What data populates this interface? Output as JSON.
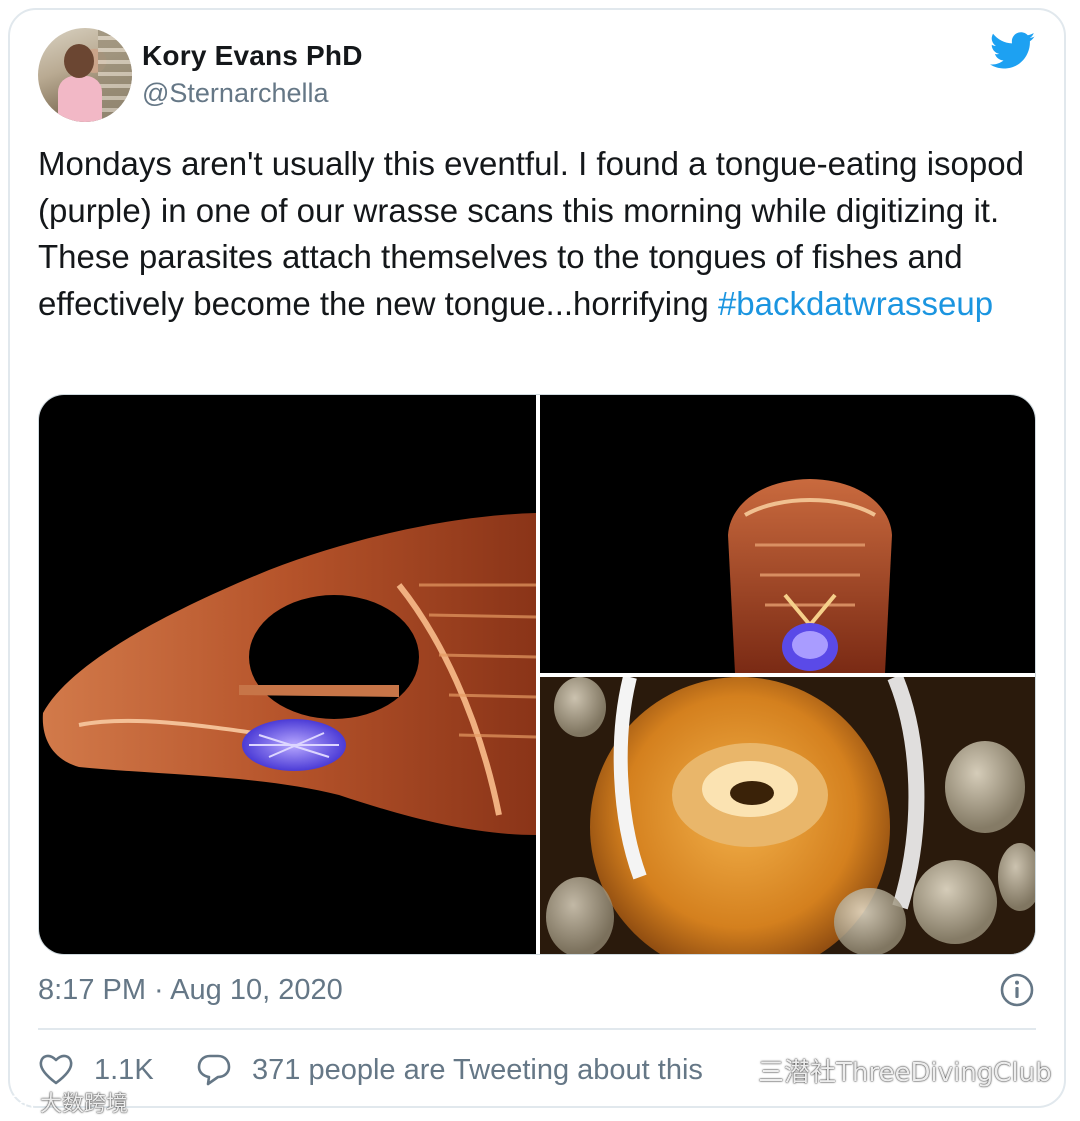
{
  "tweet": {
    "author": {
      "display_name": "Kory Evans PhD",
      "handle": "@Sternarchella",
      "avatar_icon": "profile-photo"
    },
    "text": "Mondays aren't usually this eventful. I found a tongue-eating isopod (purple) in one of our wrasse scans this morning while digitizing it. These parasites attach themselves to the tongues of fishes and effectively become the new tongue...horrifying ",
    "hashtag": "#backdatwrasseup",
    "timestamp": "8:17 PM · Aug 10, 2020",
    "likes": "1.1K",
    "discussion": "371 people are Tweeting about this",
    "media": [
      {
        "description_icon": "fish-skull-ct-scan-image"
      },
      {
        "description_icon": "fish-head-ct-scan-front-image"
      },
      {
        "description_icon": "clownfish-mouth-photo"
      }
    ]
  },
  "icons": {
    "brand": "twitter-bird-icon",
    "info": "info-icon",
    "like": "heart-icon",
    "reply": "speech-bubble-icon"
  },
  "colors": {
    "brand_blue": "#1da1f2",
    "link_blue": "#1b95e0",
    "text_primary": "#14171a",
    "text_secondary": "#657786",
    "border": "#e1e8ed"
  },
  "watermarks": {
    "right": "三潜社ThreeDivingClub",
    "left": "大数跨境"
  }
}
